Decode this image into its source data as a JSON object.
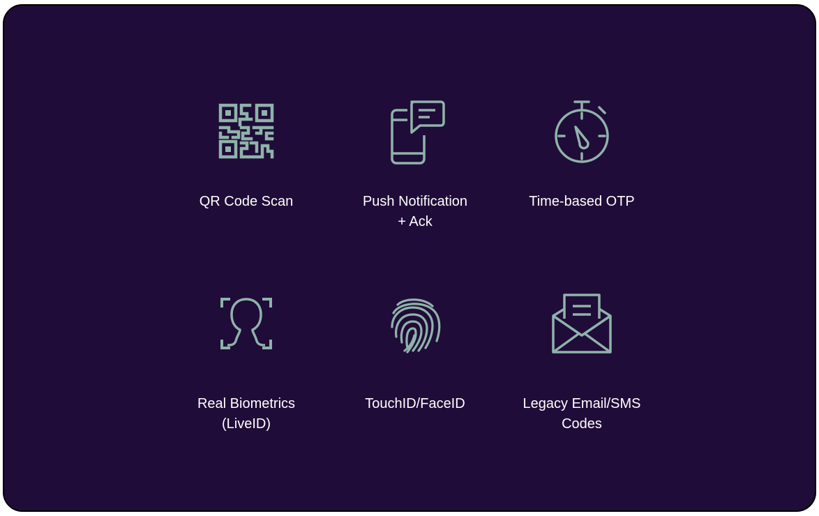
{
  "methods": [
    {
      "label": "QR Code Scan",
      "icon": "qr-code-icon"
    },
    {
      "label": "Push Notification\n+ Ack",
      "icon": "phone-message-icon"
    },
    {
      "label": "Time-based OTP",
      "icon": "stopwatch-icon"
    },
    {
      "label": "Real Biometrics\n(LiveID)",
      "icon": "face-scan-icon"
    },
    {
      "label": "TouchID/FaceID",
      "icon": "fingerprint-icon"
    },
    {
      "label": "Legacy Email/SMS\nCodes",
      "icon": "envelope-icon"
    }
  ],
  "colors": {
    "background": "#200c38",
    "icon": "#8fb3aa",
    "text": "#ffffff"
  }
}
